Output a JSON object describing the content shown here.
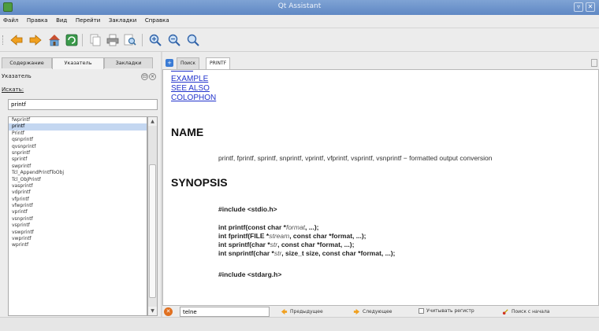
{
  "window": {
    "title": "Qt Assistant",
    "minimize_label": "▿",
    "close_label": "✕"
  },
  "menubar": [
    "Файл",
    "Правка",
    "Вид",
    "Перейти",
    "Закладки",
    "Справка"
  ],
  "toolbar": {
    "icons": [
      "back-icon",
      "forward-icon",
      "home-icon",
      "sync-icon",
      "copy-icon",
      "print-icon",
      "find-icon",
      "zoom-in-icon",
      "zoom-out-icon",
      "zoom-reset-icon"
    ]
  },
  "left": {
    "tabs": [
      "Содержание",
      "Указатель",
      "Закладки"
    ],
    "active_tab": 1,
    "index_heading": "Указатель",
    "find_label": "Искать:",
    "find_value": "printf",
    "items": [
      "fwprintf",
      "printf",
      "Printf",
      "qsnprintf",
      "qvsnprintf",
      "snprintf",
      "sprintf",
      "swprintf",
      "Tcl_AppendPrintfToObj",
      "Tcl_ObjPrintf",
      "vasprintf",
      "vdprintf",
      "vfprintf",
      "vfwprintf",
      "vprintf",
      "vsnprintf",
      "vsprintf",
      "vswprintf",
      "vwprintf",
      "wprintf"
    ],
    "selected_index": 1
  },
  "right": {
    "tabs": [
      "Поиск",
      "PRINTF"
    ],
    "active_tab": 1
  },
  "doc": {
    "links": [
      "EXAMPLE",
      "SEE ALSO",
      "COLOPHON"
    ],
    "name_heading": "NAME",
    "name_text": "printf, fprintf, sprintf, snprintf, vprintf, vfprintf, vsprintf, vsnprintf − formatted output conversion",
    "synopsis_heading": "SYNOPSIS",
    "include1": "#include <stdio.h>",
    "proto": [
      {
        "pre": "int printf(const char *",
        "arg": "format",
        "post": ", ...);"
      },
      {
        "pre": "int fprintf(FILE *",
        "arg": "stream",
        "post": ", const char *format, ...);"
      },
      {
        "pre": "int sprintf(char *",
        "arg": "str",
        "post": ", const char *format, ...);"
      },
      {
        "pre": "int snprintf(char *",
        "arg": "str",
        "post": ", size_t size, const char *format, ...);"
      }
    ],
    "include2": "#include <stdarg.h>"
  },
  "findbar": {
    "value": "telne",
    "prev_label": "Предыдущее",
    "next_label": "Следующее",
    "case_label": "Учитывать регистр",
    "wrap_label": "Поиск с начала"
  },
  "colors": {
    "title_bar": "#6a91c9",
    "selection": "#c4d7f1",
    "link": "#2233cc"
  }
}
